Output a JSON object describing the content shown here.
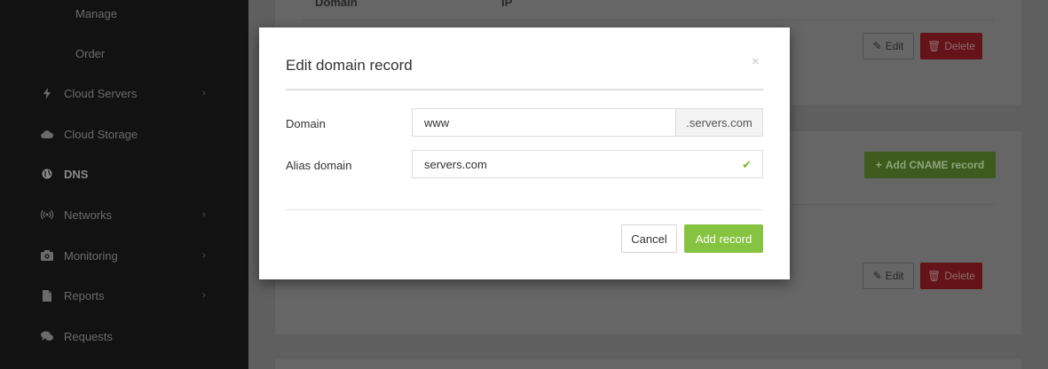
{
  "sidebar": {
    "items": [
      {
        "label": "Manage",
        "icon": "",
        "has_chevron": false
      },
      {
        "label": "Order",
        "icon": "",
        "has_chevron": false
      },
      {
        "label": "Cloud Servers",
        "icon": "lightning-icon",
        "has_chevron": true
      },
      {
        "label": "Cloud Storage",
        "icon": "cloud-icon",
        "has_chevron": false
      },
      {
        "label": "DNS",
        "icon": "globe-icon",
        "has_chevron": false,
        "active": true
      },
      {
        "label": "Networks",
        "icon": "signal-icon",
        "has_chevron": true
      },
      {
        "label": "Monitoring",
        "icon": "camera-icon",
        "has_chevron": true
      },
      {
        "label": "Reports",
        "icon": "document-icon",
        "has_chevron": true
      },
      {
        "label": "Requests",
        "icon": "chat-bubbles-icon",
        "has_chevron": false
      }
    ]
  },
  "background": {
    "table_headers": [
      "Domain",
      "IP"
    ],
    "edit_label": "Edit",
    "delete_label": "Delete",
    "add_cname_label": "Add CNAME record"
  },
  "modal": {
    "title": "Edit domain record",
    "close_glyph": "×",
    "domain_label": "Domain",
    "domain_value": "www",
    "domain_suffix": ".servers.com",
    "alias_label": "Alias domain",
    "alias_value": "servers.com",
    "cancel_label": "Cancel",
    "submit_label": "Add record"
  },
  "colors": {
    "accent_green": "#85c341",
    "delete_red": "#c9252c",
    "check_green": "#78b832"
  }
}
